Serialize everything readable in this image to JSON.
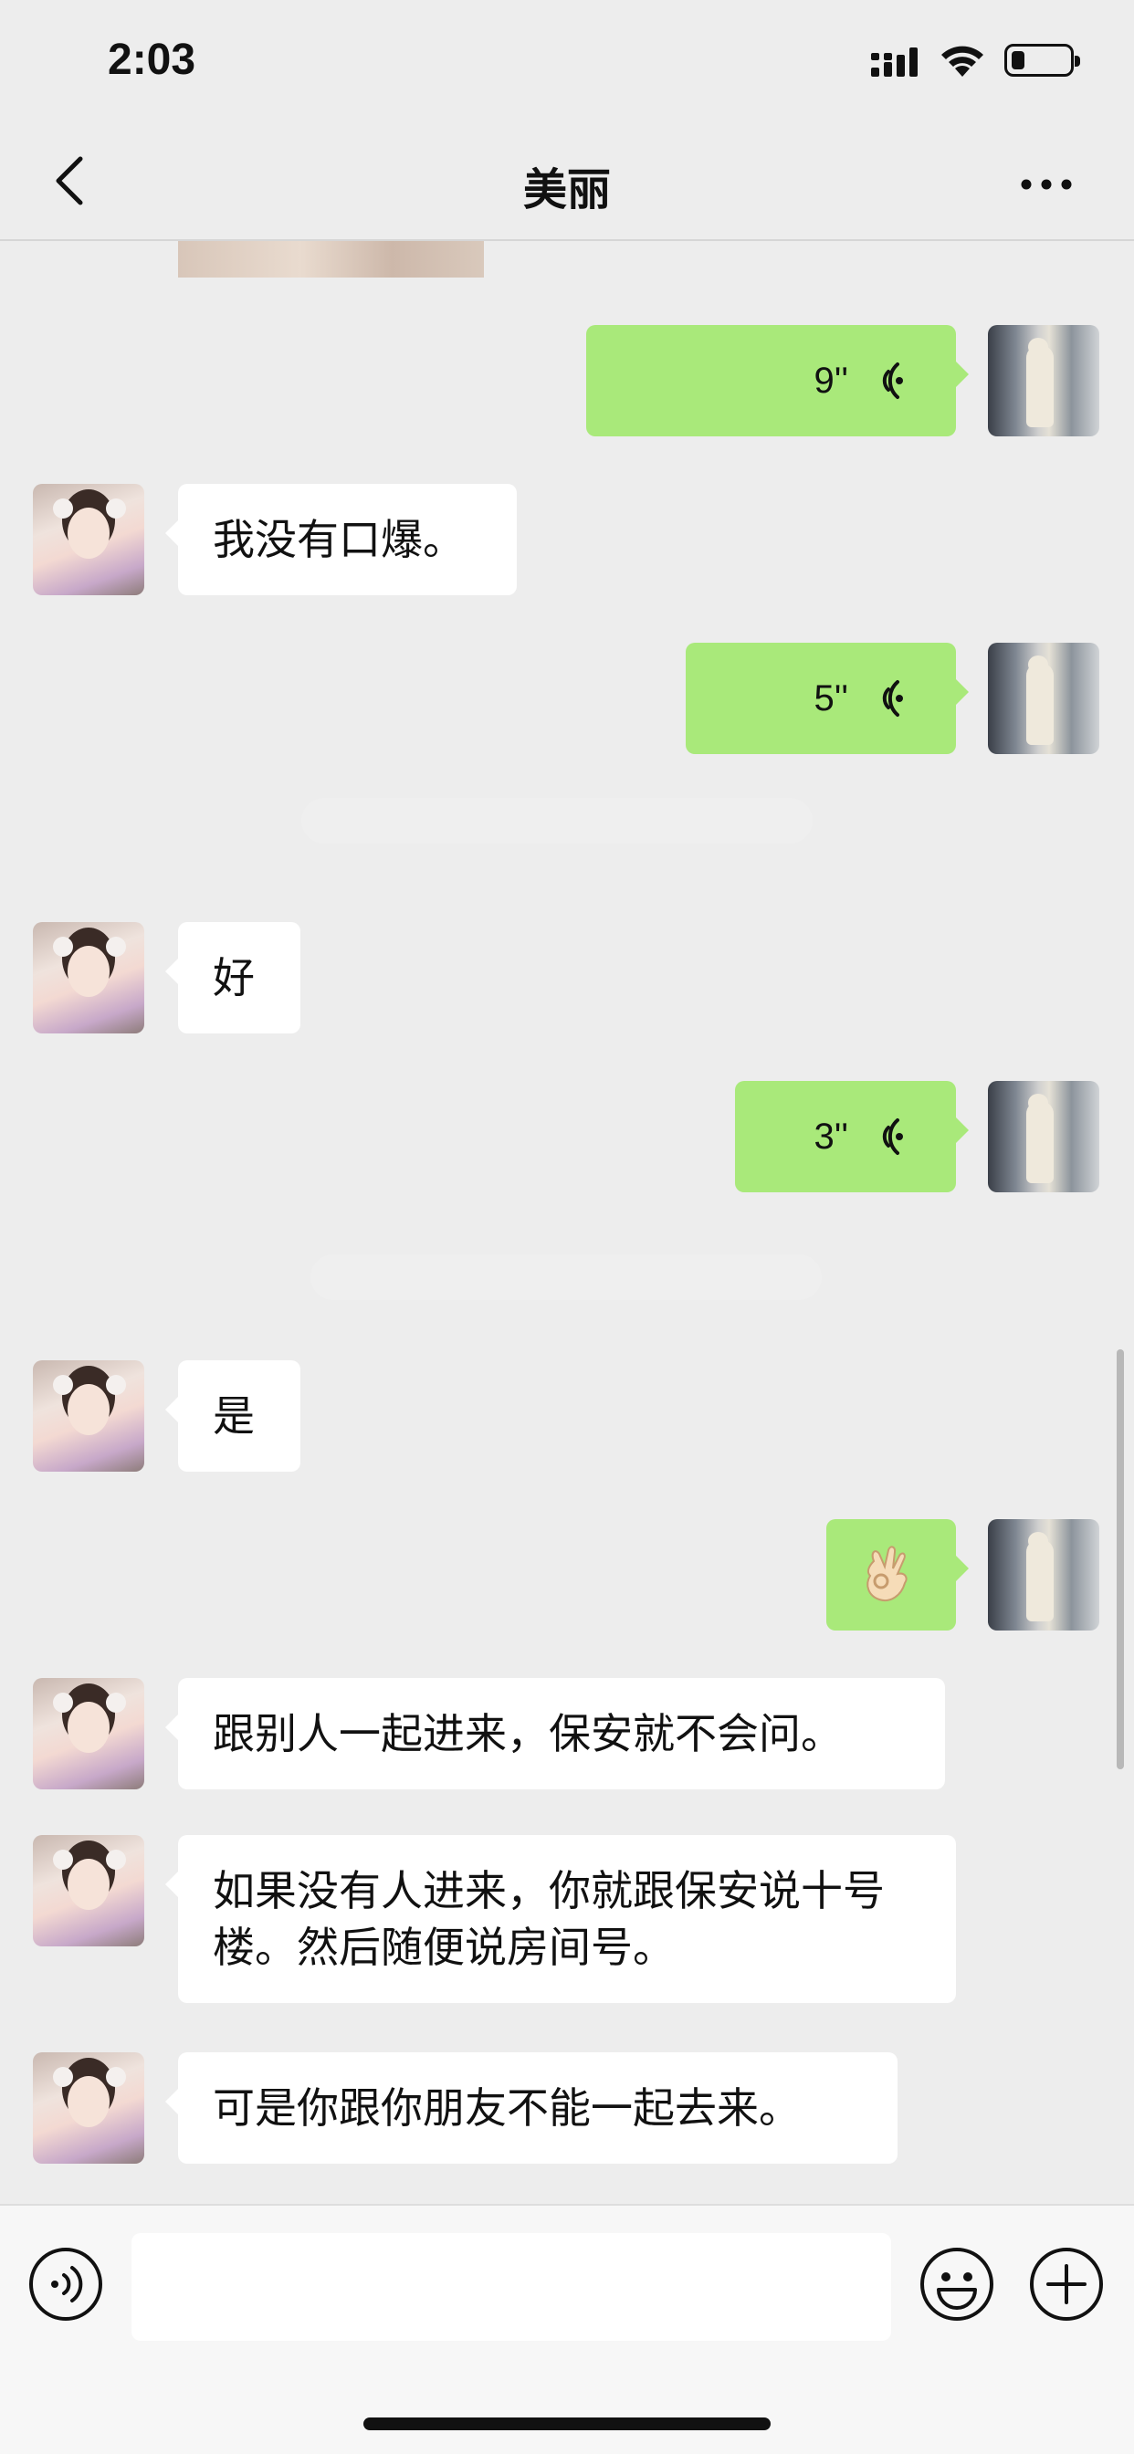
{
  "status_bar": {
    "time": "2:03"
  },
  "header": {
    "title": "美丽"
  },
  "messages": [
    {
      "side": "right",
      "type": "voice",
      "duration": "9''"
    },
    {
      "side": "left",
      "type": "text",
      "text": "我没有口爆。"
    },
    {
      "side": "right",
      "type": "voice",
      "duration": "5''"
    },
    {
      "side": "left",
      "type": "text",
      "text": "好"
    },
    {
      "side": "right",
      "type": "voice",
      "duration": "3''"
    },
    {
      "side": "left",
      "type": "text",
      "text": "是"
    },
    {
      "side": "right",
      "type": "emoji",
      "emoji": "ok-hand"
    },
    {
      "side": "left",
      "type": "text",
      "text": "跟别人一起进来，保安就不会问。"
    },
    {
      "side": "left",
      "type": "text",
      "text": "如果没有人进来，你就跟保安说十号楼。然后随便说房间号。"
    },
    {
      "side": "left",
      "type": "text",
      "text": "可是你跟你朋友不能一起去来。"
    }
  ],
  "colors": {
    "outgoing_bubble": "#a9e97a",
    "incoming_bubble": "#ffffff",
    "background": "#ededed"
  }
}
